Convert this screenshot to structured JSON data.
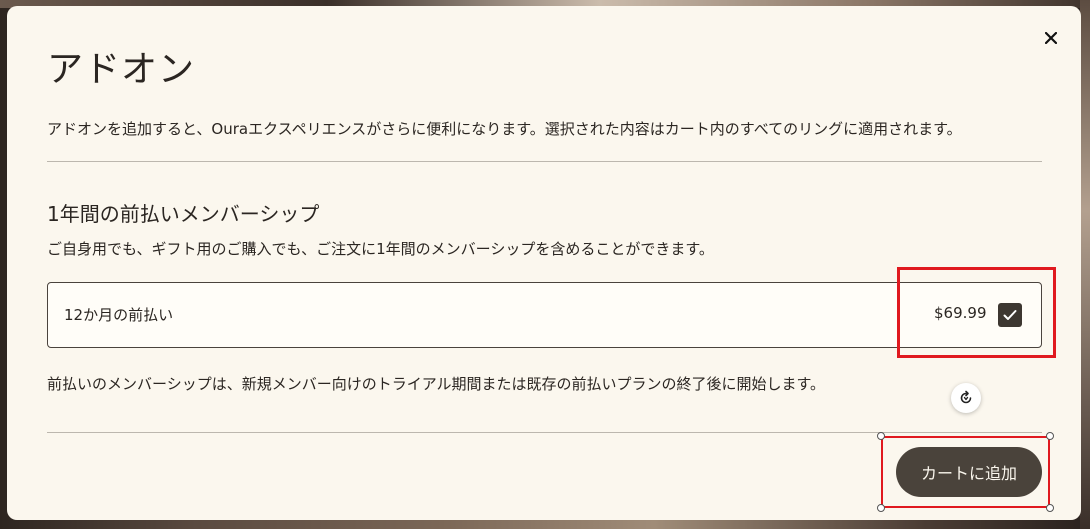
{
  "dialog": {
    "title": "アドオン",
    "description": "アドオンを追加すると、Ouraエクスペリエンスがさらに便利になります。選択された内容はカート内のすべてのリングに適用されます。",
    "close_icon": "close-icon"
  },
  "membership": {
    "section_title": "1年間の前払いメンバーシップ",
    "section_description": "ご自身用でも、ギフト用のご購入でも、ご注文に1年間のメンバーシップを含めることができます。",
    "option_label": "12か月の前払い",
    "option_price": "$69.99",
    "option_checked": true,
    "note": "前払いのメンバーシップは、新規メンバー向けのトライアル期間または既存の前払いプランの終了後に開始します。"
  },
  "footer": {
    "add_to_cart_label": "カートに追加",
    "refresh_icon": "refresh-icon"
  },
  "colors": {
    "modal_background": "#fbf7ee",
    "button_background": "#4a433b",
    "highlight": "#e0191f"
  }
}
